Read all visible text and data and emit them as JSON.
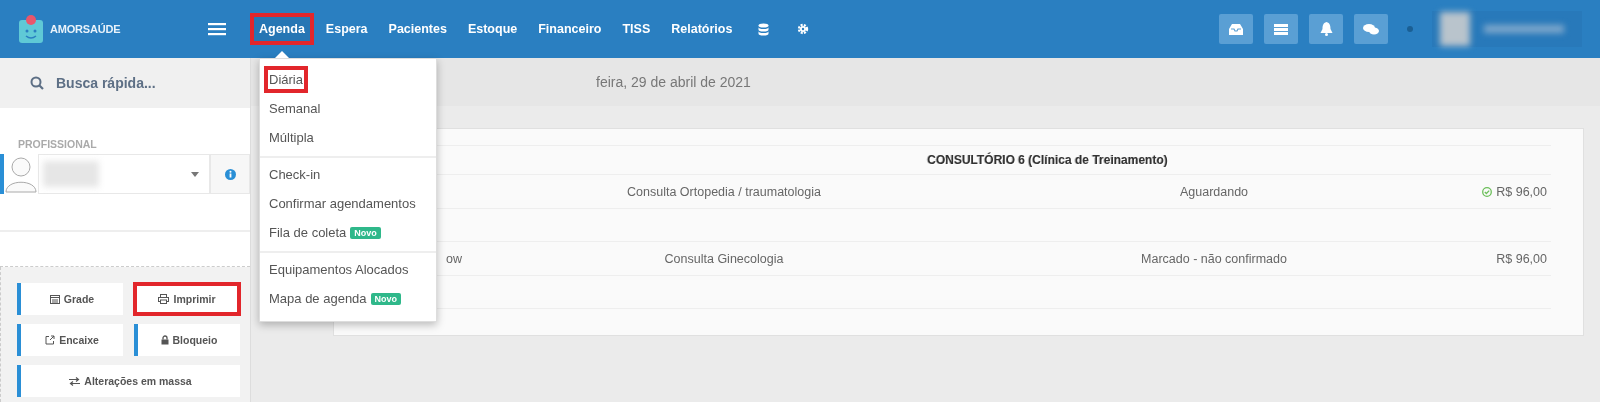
{
  "brand": {
    "name": "AMORSAÚDE"
  },
  "nav": [
    {
      "label": "Agenda",
      "selected": true,
      "highlighted": true
    },
    {
      "label": "Espera",
      "selected": false,
      "highlighted": false
    },
    {
      "label": "Pacientes",
      "selected": false,
      "highlighted": false
    },
    {
      "label": "Estoque",
      "selected": false,
      "highlighted": false
    },
    {
      "label": "Financeiro",
      "selected": false,
      "highlighted": false
    },
    {
      "label": "TISS",
      "selected": false,
      "highlighted": false
    },
    {
      "label": "Relatórios",
      "selected": false,
      "highlighted": false
    }
  ],
  "search": {
    "placeholder": "Busca rápida..."
  },
  "date_title": "feira, 29 de abril de 2021",
  "agenda_menu": [
    [
      {
        "label": "Diária",
        "highlighted": true
      },
      {
        "label": "Semanal",
        "highlighted": false
      },
      {
        "label": "Múltipla",
        "highlighted": false
      }
    ],
    [
      {
        "label": "Check-in",
        "highlighted": false
      },
      {
        "label": "Confirmar agendamentos",
        "highlighted": false
      },
      {
        "label": "Fila de coleta",
        "highlighted": false,
        "badge": "Novo"
      }
    ],
    [
      {
        "label": "Equipamentos Alocados",
        "highlighted": false
      },
      {
        "label": "Mapa de agenda",
        "highlighted": false,
        "badge": "Novo"
      }
    ]
  ],
  "sidebar": {
    "professional_label": "PROFISSIONAL",
    "buttons": [
      {
        "label": "Grade",
        "kind": "calendar",
        "highlighted": false
      },
      {
        "label": "Imprimir",
        "kind": "print",
        "highlighted": true
      },
      {
        "label": "Encaixe",
        "kind": "external",
        "highlighted": false
      },
      {
        "label": "Bloqueio",
        "kind": "lock",
        "highlighted": false
      },
      {
        "label": "Alterações em massa",
        "kind": "swap",
        "highlighted": false
      }
    ]
  },
  "schedule": {
    "room": "CONSULTÓRIO 6 (Clínica de Treinamento)",
    "rows": [
      {
        "service": "Consulta Ortopedia / traumatologia",
        "status": "Aguardando",
        "price": "R$ 96,00",
        "paid": true
      },
      {
        "patient": "ow",
        "service": "Consulta Ginecologia",
        "status": "Marcado - não confirmado",
        "price": "R$ 96,00",
        "paid": false
      }
    ]
  }
}
